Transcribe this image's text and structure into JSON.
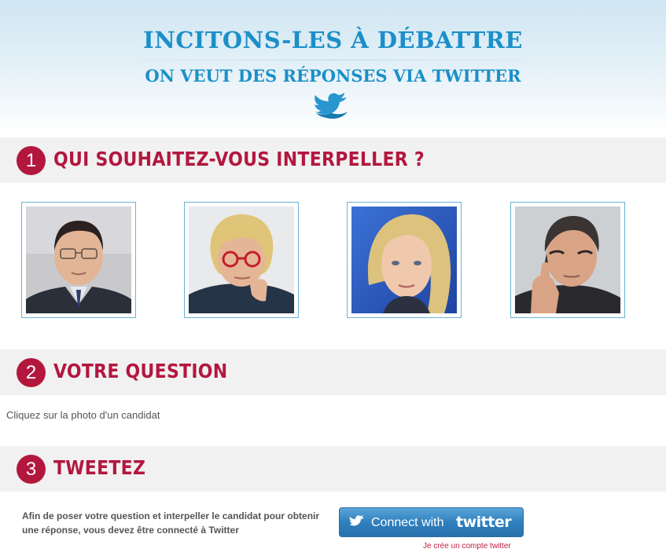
{
  "header": {
    "title": "INCITONS-LES À DÉBATTRE",
    "subtitle": "ON VEUT DES RÉPONSES VIA TWITTER",
    "logo_icon": "twitter-bird-icon"
  },
  "sections": [
    {
      "number": "1",
      "title": "QUI SOUHAITEZ-VOUS INTERPELLER ?"
    },
    {
      "number": "2",
      "title": "VOTRE QUESTION"
    },
    {
      "number": "3",
      "title": "TWEETEZ"
    }
  ],
  "candidates": [
    {
      "photo": "candidate-photo-1"
    },
    {
      "photo": "candidate-photo-2"
    },
    {
      "photo": "candidate-photo-3"
    },
    {
      "photo": "candidate-photo-4"
    }
  ],
  "question": {
    "placeholder_text": "Cliquez sur la photo d'un candidat"
  },
  "tweet": {
    "info": "Afin de poser votre question et interpeller le candidat pour obtenir une réponse, vous devez être connecté à Twitter",
    "connect_label": "Connect with",
    "connect_brand": "twitter",
    "create_account_link": "Je crée un compte twitter"
  },
  "colors": {
    "accent_red": "#b3173e",
    "title_blue": "#1b8fc9",
    "button_blue": "#2f80bf"
  }
}
